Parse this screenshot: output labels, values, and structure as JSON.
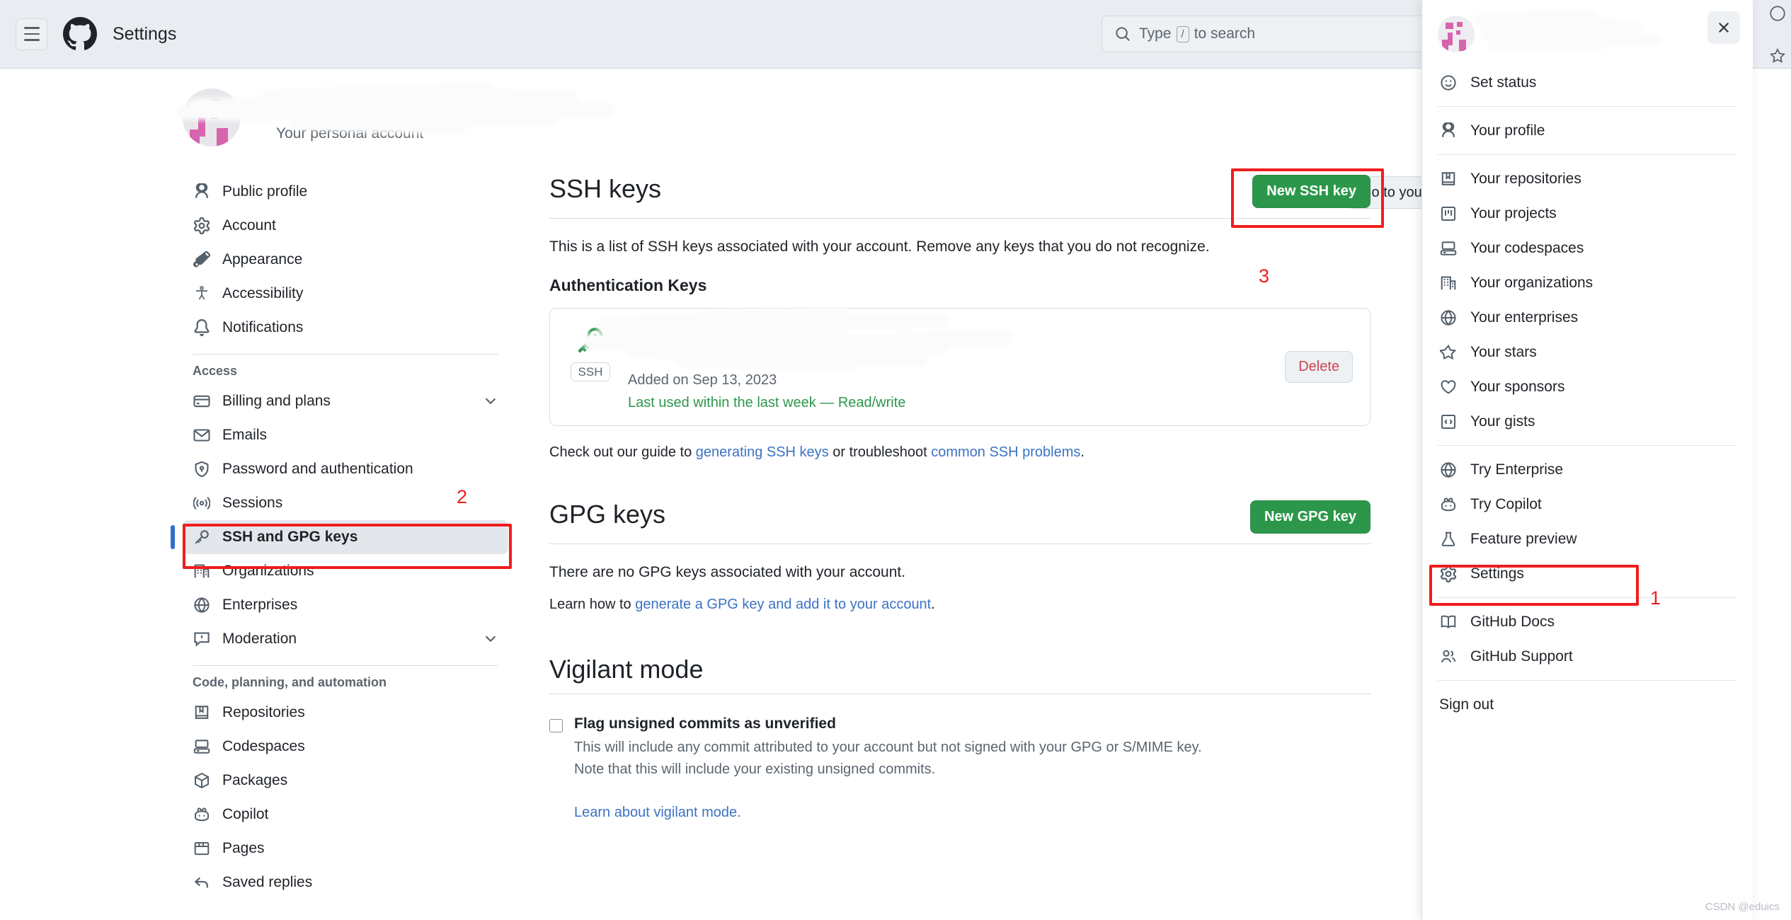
{
  "appbar": {
    "menu_icon": "hamburger-menu-icon",
    "logo_icon": "github-logo-icon",
    "title": "Settings",
    "search_placeholder_prefix": "Type",
    "search_key": "/",
    "search_placeholder_suffix": "to search",
    "search_icon": "search-icon"
  },
  "account_header": {
    "name": "",
    "subtitle": "Your personal account",
    "goto_button": "Go to you"
  },
  "sidebar": {
    "primary": [
      {
        "label": "Public profile",
        "icon": "person-icon"
      },
      {
        "label": "Account",
        "icon": "gear-icon"
      },
      {
        "label": "Appearance",
        "icon": "paintbrush-icon"
      },
      {
        "label": "Accessibility",
        "icon": "accessibility-icon"
      },
      {
        "label": "Notifications",
        "icon": "bell-icon"
      }
    ],
    "access_title": "Access",
    "access": [
      {
        "label": "Billing and plans",
        "icon": "credit-card-icon",
        "chevron": true
      },
      {
        "label": "Emails",
        "icon": "mail-icon",
        "chevron": false
      },
      {
        "label": "Password and authentication",
        "icon": "shield-lock-icon",
        "chevron": false
      },
      {
        "label": "Sessions",
        "icon": "broadcast-icon",
        "chevron": false
      },
      {
        "label": "SSH and GPG keys",
        "icon": "key-icon",
        "chevron": false,
        "selected": true
      },
      {
        "label": "Organizations",
        "icon": "organization-icon",
        "chevron": false
      },
      {
        "label": "Enterprises",
        "icon": "globe-icon",
        "chevron": false
      },
      {
        "label": "Moderation",
        "icon": "report-icon",
        "chevron": true
      }
    ],
    "code_title": "Code, planning, and automation",
    "code": [
      {
        "label": "Repositories",
        "icon": "repo-icon"
      },
      {
        "label": "Codespaces",
        "icon": "codespaces-icon"
      },
      {
        "label": "Packages",
        "icon": "package-icon"
      },
      {
        "label": "Copilot",
        "icon": "copilot-icon"
      },
      {
        "label": "Pages",
        "icon": "browser-icon"
      },
      {
        "label": "Saved replies",
        "icon": "reply-icon"
      }
    ]
  },
  "ssh_section": {
    "title": "SSH keys",
    "new_button": "New SSH key",
    "description": "This is a list of SSH keys associated with your account. Remove any keys that you do not recognize.",
    "auth_subhead": "Authentication Keys",
    "key": {
      "badge": "SSH",
      "title": "",
      "fingerprint": "",
      "added": "Added on Sep 13, 2023",
      "last_used": "Last used within the last week — Read/write",
      "delete_button": "Delete",
      "key_icon": "key-green-icon"
    },
    "guide_prefix": "Check out our guide to ",
    "guide_link1": "generating SSH keys",
    "guide_middle": " or troubleshoot ",
    "guide_link2": "common SSH problems",
    "guide_suffix": "."
  },
  "gpg_section": {
    "title": "GPG keys",
    "new_button": "New GPG key",
    "empty_text": "There are no GPG keys associated with your account.",
    "learn_prefix": "Learn how to ",
    "learn_link": "generate a GPG key and add it to your account",
    "learn_suffix": "."
  },
  "vigilant_section": {
    "title": "Vigilant mode",
    "checkbox_label": "Flag unsigned commits as unverified",
    "checkbox_checked": false,
    "desc1": "This will include any commit attributed to your account but not signed with your GPG or S/MIME key.",
    "desc2": "Note that this will include your existing unsigned commits.",
    "learn_link": "Learn about vigilant mode."
  },
  "dropdown": {
    "name": "",
    "handle": "",
    "close_icon": "close-icon",
    "set_status": {
      "label": "Set status",
      "icon": "smiley-icon"
    },
    "group1": [
      {
        "label": "Your profile",
        "icon": "person-icon"
      }
    ],
    "group2": [
      {
        "label": "Your repositories",
        "icon": "repo-icon"
      },
      {
        "label": "Your projects",
        "icon": "project-icon"
      },
      {
        "label": "Your codespaces",
        "icon": "codespaces-icon"
      },
      {
        "label": "Your organizations",
        "icon": "organization-icon"
      },
      {
        "label": "Your enterprises",
        "icon": "globe-icon"
      },
      {
        "label": "Your stars",
        "icon": "star-icon"
      },
      {
        "label": "Your sponsors",
        "icon": "heart-icon"
      },
      {
        "label": "Your gists",
        "icon": "code-square-icon"
      }
    ],
    "group3": [
      {
        "label": "Try Enterprise",
        "icon": "globe-icon"
      },
      {
        "label": "Try Copilot",
        "icon": "copilot-icon"
      },
      {
        "label": "Feature preview",
        "icon": "beaker-icon"
      },
      {
        "label": "Settings",
        "icon": "gear-icon",
        "highlighted": true
      }
    ],
    "group4": [
      {
        "label": "GitHub Docs",
        "icon": "book-icon"
      },
      {
        "label": "GitHub Support",
        "icon": "people-icon"
      }
    ],
    "sign_out": "Sign out"
  },
  "annotations": {
    "one": "1",
    "two": "2",
    "three": "3",
    "color": "#f01d1d"
  },
  "watermark": "CSDN @eduics"
}
